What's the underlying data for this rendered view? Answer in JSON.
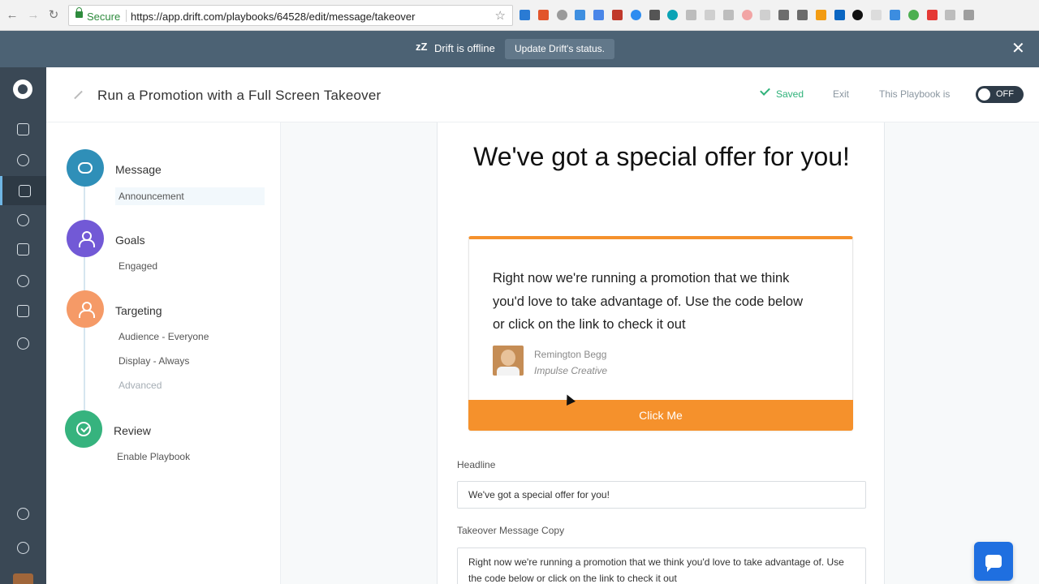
{
  "browser": {
    "secure_label": "Secure",
    "url": "https://app.drift.com/playbooks/64528/edit/message/takeover",
    "back": "←",
    "forward": "→",
    "reload": "↻",
    "star": "☆"
  },
  "banner": {
    "zz": "zZ",
    "status_text": "Drift is offline",
    "update_button": "Update Drift's status.",
    "close": "✕"
  },
  "header": {
    "title": "Run a Promotion with a Full Screen Takeover",
    "saved": "Saved",
    "exit": "Exit",
    "playbook_is": "This Playbook is",
    "toggle": "OFF"
  },
  "steps": [
    {
      "title": "Message",
      "subs": [
        "Announcement"
      ],
      "color": "#2f8fb8"
    },
    {
      "title": "Goals",
      "subs": [
        "Engaged"
      ],
      "color": "#7259d6"
    },
    {
      "title": "Targeting",
      "subs": [
        "Audience - Everyone",
        "Display - Always",
        "Advanced"
      ],
      "color": "#f59a67"
    },
    {
      "title": "Review",
      "subs": [
        "Enable Playbook"
      ],
      "color": "#36b37e"
    }
  ],
  "preview": {
    "headline": "We've got a special offer for you!",
    "copy": "Right now we're running a promotion that we think you'd love to take advantage of. Use the code below or click on the link to check it out",
    "author_name": "Remington Begg",
    "author_company": "Impulse Creative",
    "cta": "Click Me"
  },
  "form": {
    "headline_label": "Headline",
    "headline_value": "We've got a special offer for you!",
    "copy_label": "Takeover Message Copy",
    "copy_value": "Right now we're running a promotion that we think you'd love to take advantage of. Use the code below or click on the link to check it out"
  },
  "colors": {
    "accent_orange": "#f5912c",
    "rail": "#3a4855",
    "banner": "#4c6274",
    "saved_green": "#2fb27a"
  }
}
